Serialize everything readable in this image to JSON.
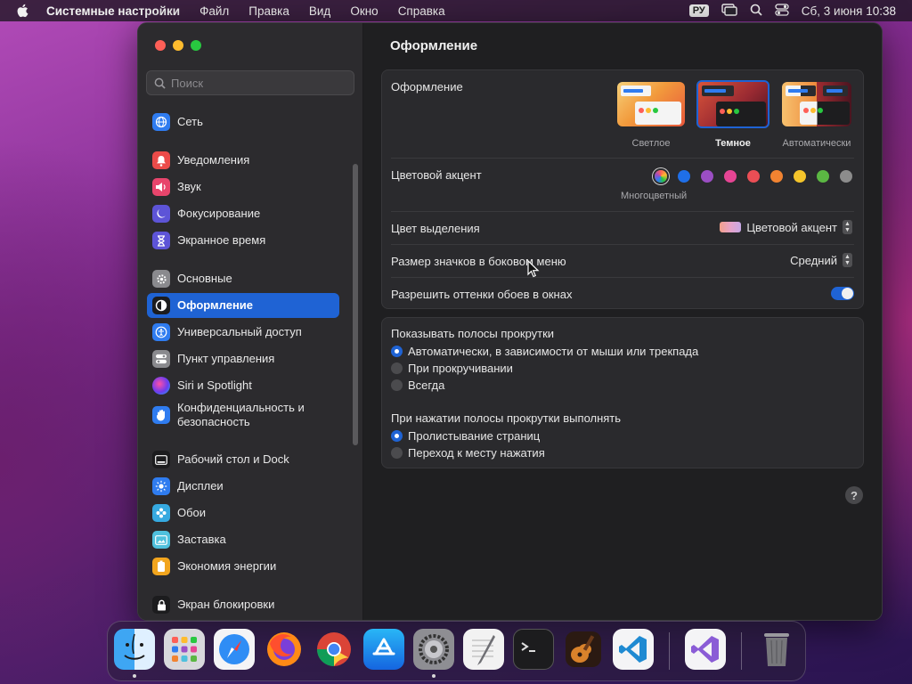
{
  "menubar": {
    "app_name": "Системные настройки",
    "items": [
      "Файл",
      "Правка",
      "Вид",
      "Окно",
      "Справка"
    ],
    "input_lang": "РУ",
    "clock": "Сб, 3 июня  10:38"
  },
  "sidebar": {
    "search_placeholder": "Поиск",
    "items": [
      {
        "label": "Сеть",
        "icon": "network-icon",
        "color": "#2f7cf0"
      },
      {
        "label": "Уведомления",
        "icon": "bell-icon",
        "color": "#eb4b49"
      },
      {
        "label": "Звук",
        "icon": "speaker-icon",
        "color": "#e8456c"
      },
      {
        "label": "Фокусирование",
        "icon": "moon-icon",
        "color": "#5d54d7"
      },
      {
        "label": "Экранное время",
        "icon": "hourglass-icon",
        "color": "#5d54d7"
      },
      {
        "label": "Основные",
        "icon": "gear-icon",
        "color": "#8a8a8e"
      },
      {
        "label": "Оформление",
        "icon": "appearance-icon",
        "color": "#1c1c1e"
      },
      {
        "label": "Универсальный доступ",
        "icon": "accessibility-icon",
        "color": "#2f7cf0"
      },
      {
        "label": "Пункт управления",
        "icon": "control-center-icon",
        "color": "#8a8a8e"
      },
      {
        "label": "Siri и Spotlight",
        "icon": "siri-icon",
        "color": "#a03ad8"
      },
      {
        "label": "Конфиденциальность и безопасность",
        "icon": "hand-icon",
        "color": "#2f7cf0"
      },
      {
        "label": "Рабочий стол и Dock",
        "icon": "dock-icon",
        "color": "#1c1c1e"
      },
      {
        "label": "Дисплеи",
        "icon": "display-icon",
        "color": "#2f7cf0"
      },
      {
        "label": "Обои",
        "icon": "wallpaper-icon",
        "color": "#36a9e0"
      },
      {
        "label": "Заставка",
        "icon": "screensaver-icon",
        "color": "#4fc0dd"
      },
      {
        "label": "Экономия энергии",
        "icon": "battery-icon",
        "color": "#f2a51e"
      },
      {
        "label": "Экран блокировки",
        "icon": "lock-icon",
        "color": "#1c1c1e"
      }
    ]
  },
  "main": {
    "title": "Оформление",
    "appearance": {
      "label": "Оформление",
      "options": [
        "Светлое",
        "Темное",
        "Автоматически"
      ],
      "selected": "Темное"
    },
    "accent": {
      "label": "Цветовой акцент",
      "colors": [
        "multicolor",
        "#1f6fe8",
        "#9b4ec3",
        "#e64594",
        "#eb4e55",
        "#f18331",
        "#f5c52b",
        "#5bb743",
        "#8c8c8c"
      ],
      "selected_caption": "Многоцветный"
    },
    "highlight": {
      "label": "Цвет выделения",
      "value": "Цветовой акцент"
    },
    "icon_size": {
      "label": "Размер значков в боковом меню",
      "value": "Средний"
    },
    "tinting": {
      "label": "Разрешить оттенки обоев в окнах",
      "enabled": true
    },
    "scrollbars": {
      "label": "Показывать полосы прокрутки",
      "options": [
        "Автоматически, в зависимости от мыши или трекпада",
        "При прокручивании",
        "Всегда"
      ],
      "selected_index": 0
    },
    "scroll_click": {
      "label": "При нажатии полосы прокрутки выполнять",
      "options": [
        "Пролистывание страниц",
        "Переход к месту нажатия"
      ],
      "selected_index": 0
    },
    "help": "?"
  },
  "dock": {
    "apps": [
      "finder-icon",
      "launchpad-icon",
      "safari-icon",
      "firefox-icon",
      "chrome-icon",
      "app-store-icon",
      "system-settings-icon",
      "textedit-icon",
      "terminal-icon",
      "garageband-icon",
      "vscode-icon",
      "visual-studio-icon",
      "trash-icon"
    ]
  }
}
